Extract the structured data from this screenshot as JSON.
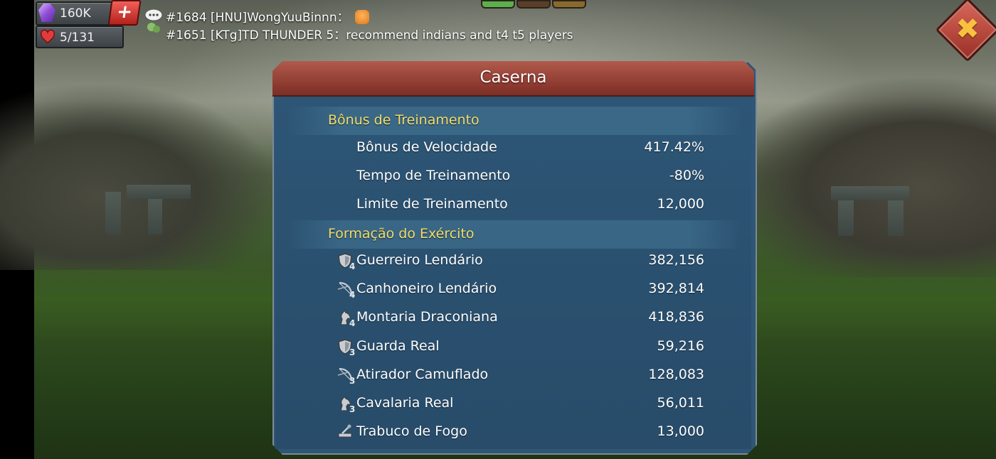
{
  "hud": {
    "gems": "160K",
    "gem_icon": "gem-icon",
    "stamina": "5/131",
    "stamina_icon": "heart-icon",
    "plus_label": "+"
  },
  "chat": {
    "line1": "#1684 [HNU]WongYuuBinnn：",
    "line2": "#1651 [KTg]TD THUNDER 5：recommend indians and t4 t5 players"
  },
  "colors": {
    "panel_bg": "#2d5575",
    "header_red": "#8d3a30",
    "section_gold": "#f4dd6a",
    "close_gold": "#f7c23f"
  },
  "panel": {
    "title": "Caserna",
    "training_bonus": {
      "title": "Bônus de Treinamento",
      "rows": [
        {
          "label": "Bônus de Velocidade",
          "value": "417.42%"
        },
        {
          "label": "Tempo de Treinamento",
          "value": "-80%"
        },
        {
          "label": "Limite de Treinamento",
          "value": "12,000"
        }
      ]
    },
    "army": {
      "title": "Formação do Exército",
      "rows": [
        {
          "label": "Guerreiro Lendário",
          "value": "382,156",
          "tier": "4",
          "icon": "infantry-shield-icon"
        },
        {
          "label": "Canhoneiro Lendário",
          "value": "392,814",
          "tier": "4",
          "icon": "ranged-bow-icon"
        },
        {
          "label": "Montaria Draconiana",
          "value": "418,836",
          "tier": "4",
          "icon": "cavalry-horse-icon"
        },
        {
          "label": "Guarda Real",
          "value": "59,216",
          "tier": "3",
          "icon": "infantry-shield-icon"
        },
        {
          "label": "Atirador Camuflado",
          "value": "128,083",
          "tier": "3",
          "icon": "ranged-bow-icon"
        },
        {
          "label": "Cavalaria Real",
          "value": "56,011",
          "tier": "3",
          "icon": "cavalry-horse-icon"
        },
        {
          "label": "Trabuco de Fogo",
          "value": "13,000",
          "tier": "",
          "icon": "siege-catapult-icon"
        }
      ]
    }
  },
  "close_label": "✖"
}
